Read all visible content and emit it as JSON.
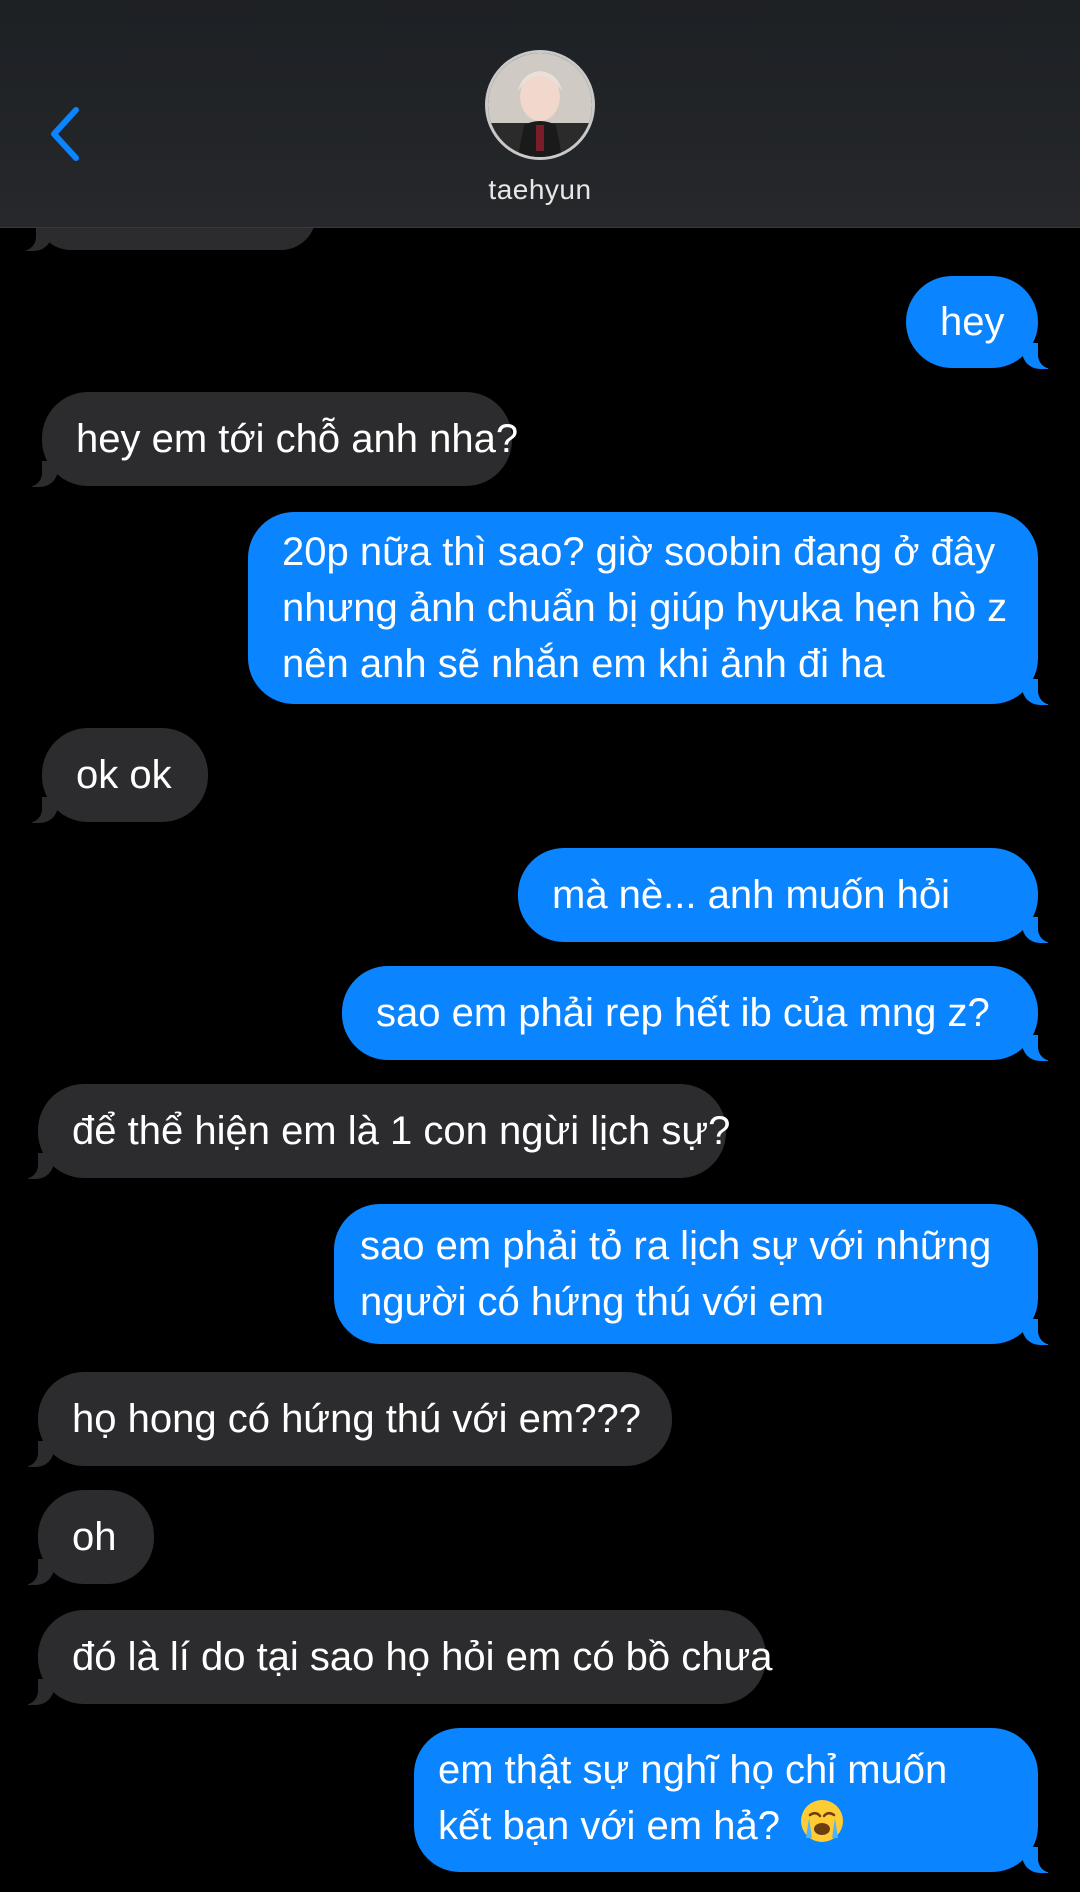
{
  "header": {
    "contact_name": "taehyun",
    "back_icon": "chevron-left-icon",
    "avatar_icon": "profile-photo"
  },
  "colors": {
    "sent_bubble": "#0b84ff",
    "received_bubble": "#2c2c2e",
    "background": "#000000",
    "back_arrow": "#0b84ff"
  },
  "messages": [
    {
      "from": "me",
      "text": "hey"
    },
    {
      "from": "them",
      "text": "hey em tới chỗ anh nha?"
    },
    {
      "from": "me",
      "text": "20p nữa thì sao? giờ soobin đang ở đây nhưng ảnh chuẩn bị giúp hyuka hẹn hò z nên anh sẽ nhắn em khi ảnh đi ha"
    },
    {
      "from": "them",
      "text": "ok ok"
    },
    {
      "from": "me",
      "text": "mà nè... anh muốn hỏi"
    },
    {
      "from": "me",
      "text": "sao em phải rep hết ib của mng z?"
    },
    {
      "from": "them",
      "text": "để thể hiện em là 1 con ngừi lịch sự?"
    },
    {
      "from": "me",
      "text": "sao em phải tỏ ra lịch sự với những người có hứng thú với em"
    },
    {
      "from": "them",
      "text": "họ hong có hứng thú với em???"
    },
    {
      "from": "them",
      "text": "oh"
    },
    {
      "from": "them",
      "text": "đó là lí do tại sao họ hỏi em có bồ chưa"
    },
    {
      "from": "me",
      "text": "em thật sự nghĩ họ chỉ muốn kết bạn với em hả?",
      "emoji": "loudly-crying-face-emoji"
    }
  ]
}
